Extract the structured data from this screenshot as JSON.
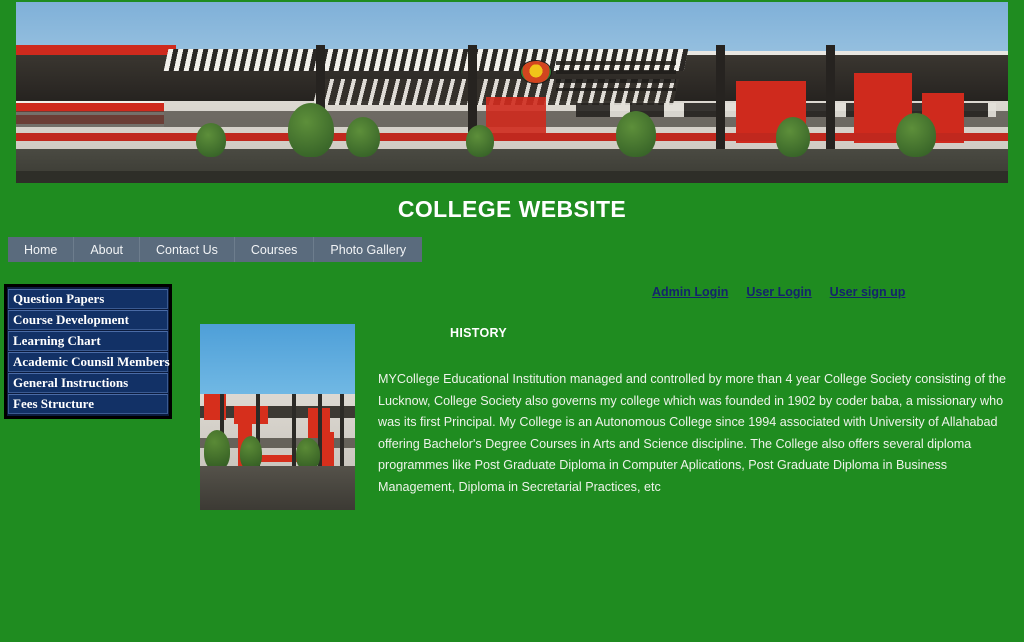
{
  "site": {
    "title": "COLLEGE WEBSITE",
    "background_color": "#1f8c20",
    "banner_alt": "college-building-banner"
  },
  "nav": {
    "items": [
      {
        "label": "Home",
        "name": "nav-item-home"
      },
      {
        "label": "About",
        "name": "nav-item-about"
      },
      {
        "label": "Contact Us",
        "name": "nav-item-contact-us"
      },
      {
        "label": "Courses",
        "name": "nav-item-courses"
      },
      {
        "label": "Photo Gallery",
        "name": "nav-item-photo-gallery"
      }
    ],
    "background_color": "#5a6b7d",
    "text_color": "#f2f4f6"
  },
  "sidebar": {
    "background_color": "#123166",
    "border_color": "#000000",
    "items": [
      {
        "label": "Question Papers"
      },
      {
        "label": "Course Development"
      },
      {
        "label": "Learning Chart"
      },
      {
        "label": "Academic Counsil Members"
      },
      {
        "label": "General Instructions"
      },
      {
        "label": "Fees Structure"
      }
    ]
  },
  "auth_links": {
    "color": "#14246b",
    "items": [
      {
        "label": "Admin Login",
        "name": "admin-login-link"
      },
      {
        "label": "User Login",
        "name": "user-login-link"
      },
      {
        "label": "User sign up",
        "name": "user-signup-link"
      }
    ]
  },
  "content": {
    "thumbnail_alt": "college-building-photo",
    "history_heading": "HISTORY",
    "history_text": "MYCollege Educational Institution managed and controlled by more than 4 year College Society consisting of the Lucknow, College Society also governs my college which was founded in 1902 by coder baba, a missionary who was its first Principal. My College is an Autonomous College since 1994 associated with University of Allahabad offering Bachelor's Degree Courses in Arts and Science discipline. The College also offers several diploma programmes like Post Graduate Diploma in Computer Aplications, Post Graduate Diploma in Business Management, Diploma in Secretarial Practices, etc"
  }
}
